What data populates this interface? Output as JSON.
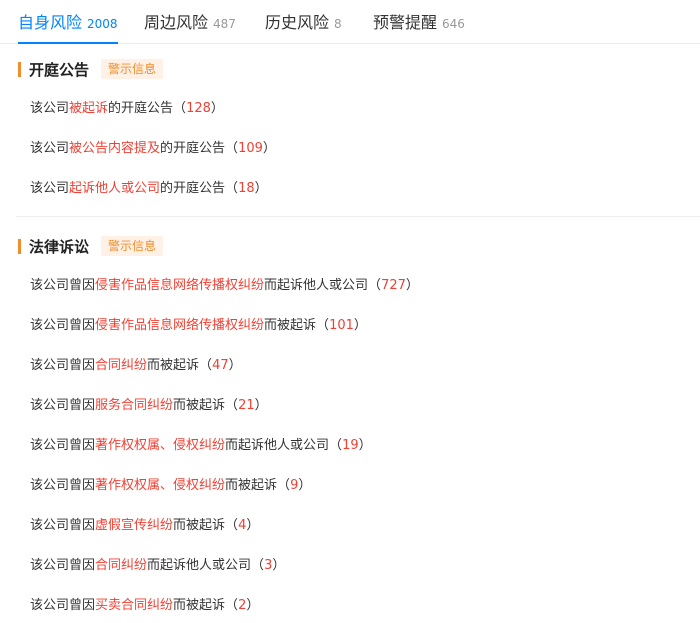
{
  "tabs": [
    {
      "label": "自身风险",
      "count": "2008"
    },
    {
      "label": "周边风险",
      "count": "487"
    },
    {
      "label": "历史风险",
      "count": "8"
    },
    {
      "label": "预警提醒",
      "count": "646"
    }
  ],
  "colors": {
    "accent": "#0084ff",
    "warning": "#f08d2c",
    "highlight": "#f04134"
  },
  "sections": [
    {
      "title": "开庭公告",
      "badge": "警示信息",
      "rows": [
        {
          "prefix": "该公司",
          "highlight": "被起诉",
          "suffix": "的开庭公告",
          "count": "128"
        },
        {
          "prefix": "该公司",
          "highlight": "被公告内容提及",
          "suffix": "的开庭公告",
          "count": "109"
        },
        {
          "prefix": "该公司",
          "highlight": "起诉他人或公司",
          "suffix": "的开庭公告",
          "count": "18"
        }
      ]
    },
    {
      "title": "法律诉讼",
      "badge": "警示信息",
      "rows": [
        {
          "prefix": "该公司曾因",
          "highlight": "侵害作品信息网络传播权纠纷",
          "suffix": "而起诉他人或公司",
          "count": "727"
        },
        {
          "prefix": "该公司曾因",
          "highlight": "侵害作品信息网络传播权纠纷",
          "suffix": "而被起诉",
          "count": "101"
        },
        {
          "prefix": "该公司曾因",
          "highlight": "合同纠纷",
          "suffix": "而被起诉",
          "count": "47"
        },
        {
          "prefix": "该公司曾因",
          "highlight": "服务合同纠纷",
          "suffix": "而被起诉",
          "count": "21"
        },
        {
          "prefix": "该公司曾因",
          "highlight": "著作权权属、侵权纠纷",
          "suffix": "而起诉他人或公司",
          "count": "19"
        },
        {
          "prefix": "该公司曾因",
          "highlight": "著作权权属、侵权纠纷",
          "suffix": "而被起诉",
          "count": "9"
        },
        {
          "prefix": "该公司曾因",
          "highlight": "虚假宣传纠纷",
          "suffix": "而被起诉",
          "count": "4"
        },
        {
          "prefix": "该公司曾因",
          "highlight": "合同纠纷",
          "suffix": "而起诉他人或公司",
          "count": "3"
        },
        {
          "prefix": "该公司曾因",
          "highlight": "买卖合同纠纷",
          "suffix": "而被起诉",
          "count": "2"
        }
      ]
    }
  ]
}
